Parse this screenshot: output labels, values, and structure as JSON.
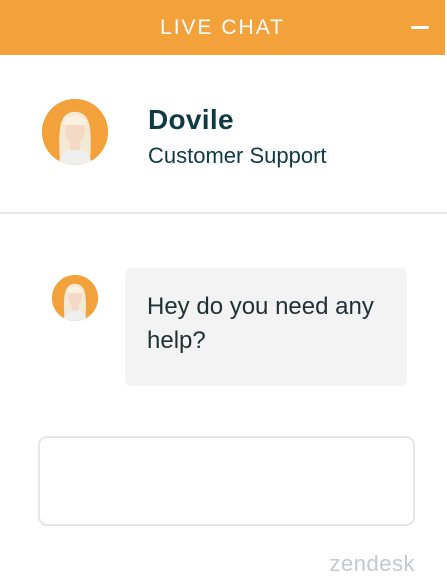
{
  "header": {
    "title": "LIVE CHAT",
    "minimize_icon": "minus-icon"
  },
  "agent": {
    "name": "Dovile",
    "role": "Customer Support",
    "avatar": "agent-photo-avatar"
  },
  "messages": [
    {
      "text": "Hey do you need any help?"
    }
  ],
  "input": {
    "value": "",
    "placeholder": ""
  },
  "branding": {
    "text": "zendesk"
  },
  "colors": {
    "accent": "#F3A13A",
    "text_dark": "#0E3A44",
    "bubble_bg": "#F3F3F3",
    "brand_gray": "#C3C9CC"
  }
}
